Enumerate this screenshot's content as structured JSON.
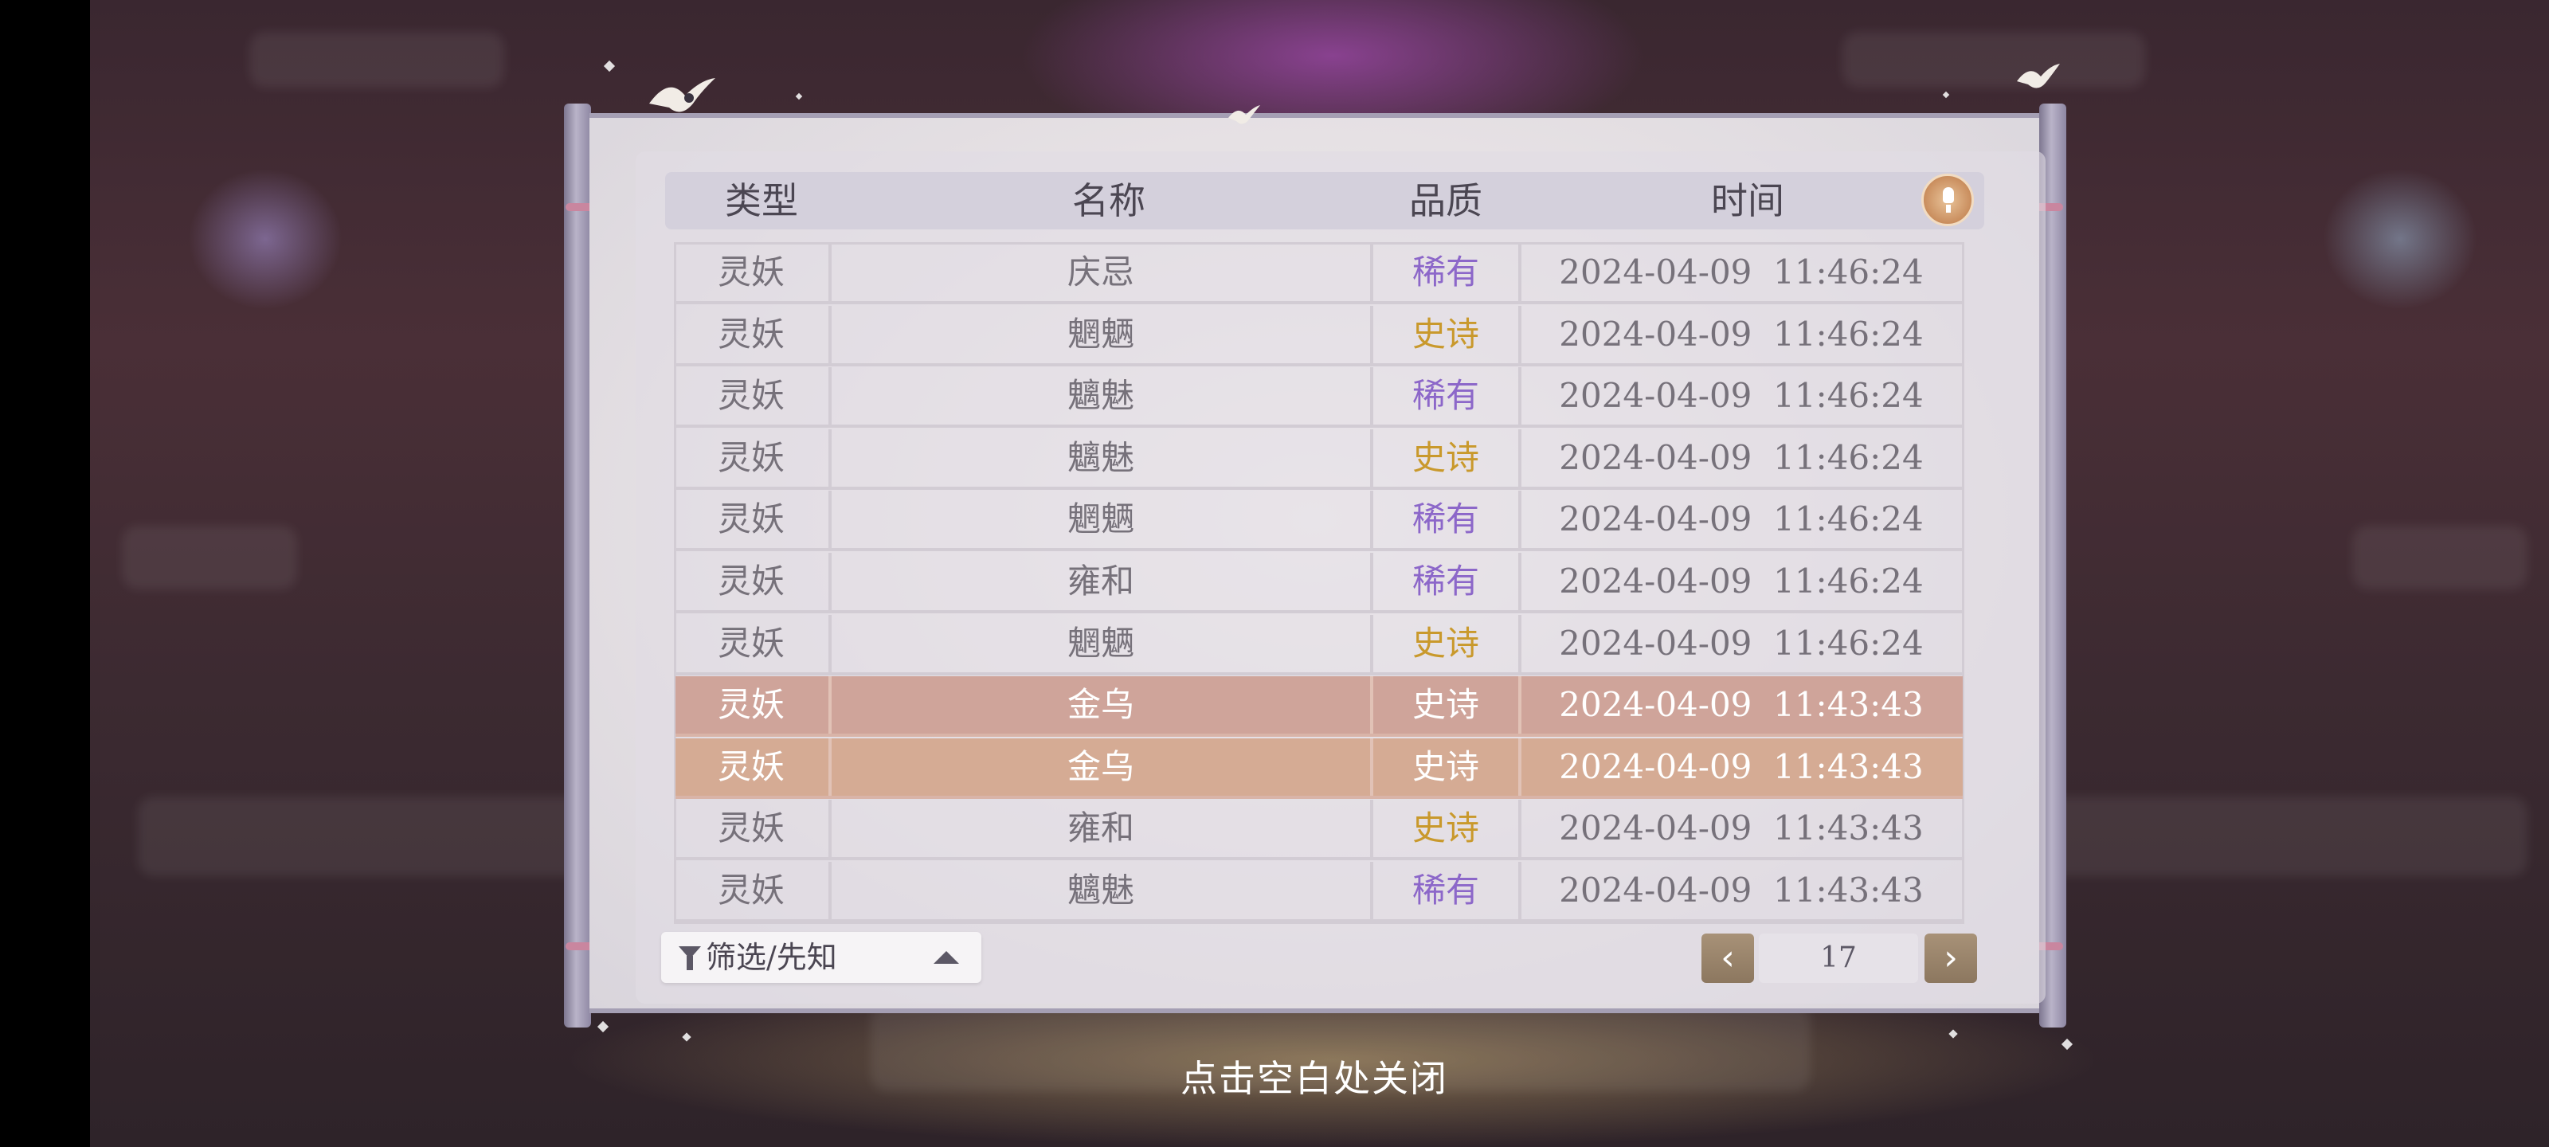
{
  "headers": [
    "类型",
    "名称",
    "品质",
    "时间"
  ],
  "rows": [
    {
      "type": "灵妖",
      "name": "庆忌",
      "quality": "稀有",
      "quality_class": "rare",
      "time": "2024-04-09  11:46:24",
      "highlight": false
    },
    {
      "type": "灵妖",
      "name": "魍魉",
      "quality": "史诗",
      "quality_class": "epic",
      "time": "2024-04-09  11:46:24",
      "highlight": false
    },
    {
      "type": "灵妖",
      "name": "魑魅",
      "quality": "稀有",
      "quality_class": "rare",
      "time": "2024-04-09  11:46:24",
      "highlight": false
    },
    {
      "type": "灵妖",
      "name": "魑魅",
      "quality": "史诗",
      "quality_class": "epic",
      "time": "2024-04-09  11:46:24",
      "highlight": false
    },
    {
      "type": "灵妖",
      "name": "魍魉",
      "quality": "稀有",
      "quality_class": "rare",
      "time": "2024-04-09  11:46:24",
      "highlight": false
    },
    {
      "type": "灵妖",
      "name": "雍和",
      "quality": "稀有",
      "quality_class": "rare",
      "time": "2024-04-09  11:46:24",
      "highlight": false
    },
    {
      "type": "灵妖",
      "name": "魍魉",
      "quality": "史诗",
      "quality_class": "epic",
      "time": "2024-04-09  11:46:24",
      "highlight": false
    },
    {
      "type": "灵妖",
      "name": "金乌",
      "quality": "史诗",
      "quality_class": "epic",
      "time": "2024-04-09  11:43:43",
      "highlight": true
    },
    {
      "type": "灵妖",
      "name": "金乌",
      "quality": "史诗",
      "quality_class": "epic",
      "time": "2024-04-09  11:43:43",
      "highlight": true
    },
    {
      "type": "灵妖",
      "name": "雍和",
      "quality": "史诗",
      "quality_class": "epic",
      "time": "2024-04-09  11:43:43",
      "highlight": false
    },
    {
      "type": "灵妖",
      "name": "魑魅",
      "quality": "稀有",
      "quality_class": "rare",
      "time": "2024-04-09  11:43:43",
      "highlight": false
    }
  ],
  "filter": {
    "label": "筛选/先知"
  },
  "pagination": {
    "prev": "‹",
    "page": "17",
    "next": "›"
  },
  "close_hint": "点击空白处关闭",
  "colors": {
    "rare": "#8c67c9",
    "epic": "#c9992c",
    "highlight_row": "#cfa49a"
  },
  "icons": {
    "help": "lightbulb-icon",
    "filter": "filter-icon",
    "sort": "caret-up-icon"
  }
}
